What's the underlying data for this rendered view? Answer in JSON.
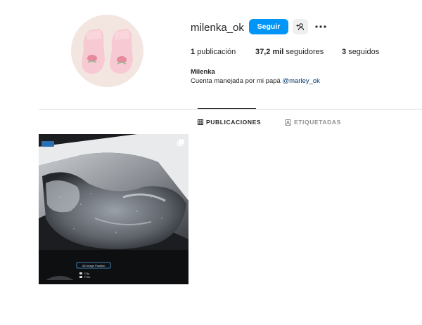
{
  "profile": {
    "username": "milenka_ok",
    "full_name": "Milenka",
    "bio_text": "Cuenta manejada por mi papá",
    "bio_mention": "@marley_ok",
    "avatar_icon": "baby-booties-photo"
  },
  "actions": {
    "follow_label": "Seguir",
    "suggest_icon": "person-plus-icon",
    "more_icon": "ellipsis-icon"
  },
  "stats": {
    "posts_count": "1",
    "posts_label": "publicación",
    "followers_count": "37,2 mil",
    "followers_label": "seguidores",
    "following_count": "3",
    "following_label": "seguidos"
  },
  "tabs": [
    {
      "label": "PUBLICACIONES",
      "icon": "grid-icon",
      "active": true
    },
    {
      "label": "ETIQUETADAS",
      "icon": "tagged-user-icon",
      "active": false
    }
  ],
  "posts": [
    {
      "type": "carousel",
      "description_icon": "multiple-images-icon",
      "overlay_text": "3D Image Position",
      "footer_text": [
        "Clip",
        "Print"
      ]
    }
  ],
  "colors": {
    "accent": "#0095f6",
    "text": "#262626",
    "muted": "#8e8e8e",
    "mention": "#00376b",
    "divider": "#dbdbdb"
  }
}
